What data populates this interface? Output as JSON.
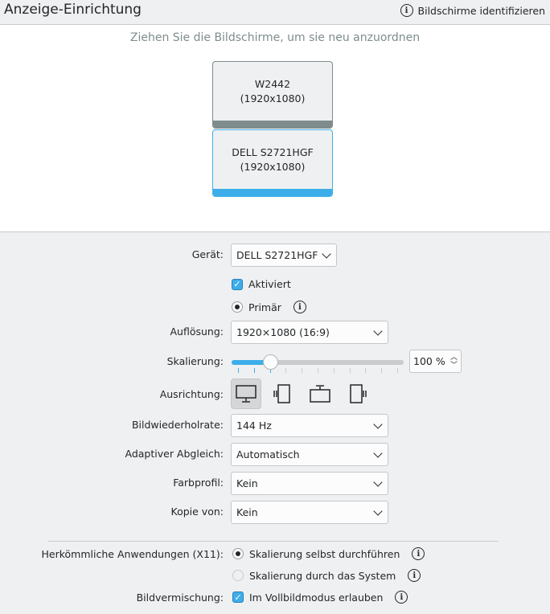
{
  "header": {
    "title": "Anzeige-Einrichtung",
    "identify_label": "Bildschirme identifizieren"
  },
  "arrangement": {
    "hint": "Ziehen Sie die Bildschirme, um sie neu anzuordnen",
    "monitors": [
      {
        "name": "W2442",
        "resolution": "(1920x1080)",
        "selected": false
      },
      {
        "name": "DELL S2721HGF",
        "resolution": "(1920x1080)",
        "selected": true
      }
    ]
  },
  "settings": {
    "device_label": "Gerät:",
    "device_value": "DELL S2721HGF",
    "enabled_label": "Aktiviert",
    "enabled": true,
    "primary_label": "Primär",
    "primary": true,
    "resolution_label": "Auflösung:",
    "resolution_value": "1920×1080 (16:9)",
    "scaling_label": "Skalierung:",
    "scaling_value": "100 %",
    "scaling_slider_fraction": 0.2,
    "orientation_label": "Ausrichtung:",
    "orientation_options": [
      "landscape",
      "portrait-left",
      "landscape-flipped",
      "portrait-right"
    ],
    "orientation_selected": 0,
    "refresh_label": "Bildwiederholrate:",
    "refresh_value": "144 Hz",
    "adaptive_label": "Adaptiver Abgleich:",
    "adaptive_value": "Automatisch",
    "color_profile_label": "Farbprofil:",
    "color_profile_value": "Kein",
    "mirror_label": "Kopie von:",
    "mirror_value": "Kein",
    "legacy_label": "Herkömmliche Anwendungen (X11):",
    "legacy_opt1": "Skalierung selbst durchführen",
    "legacy_opt2": "Skalierung durch das System",
    "legacy_selected": 0,
    "tearing_label": "Bildvermischung:",
    "tearing_opt": "Im Vollbildmodus erlauben",
    "tearing": true
  },
  "colors": {
    "accent": "#3daee9",
    "inactive": "#7f8c8d"
  }
}
